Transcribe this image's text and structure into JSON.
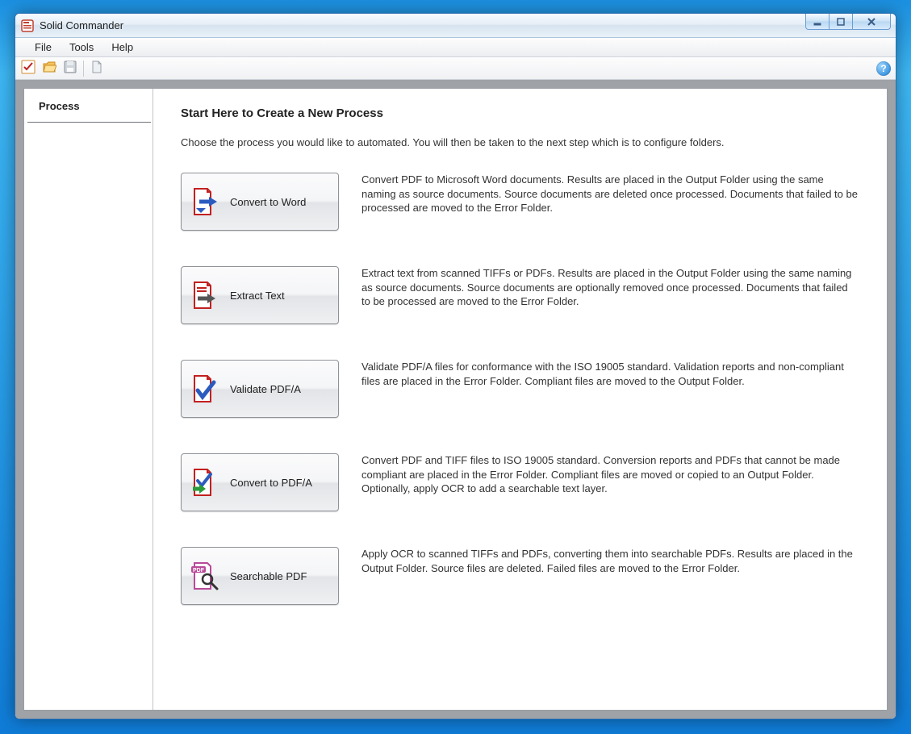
{
  "app": {
    "title": "Solid Commander"
  },
  "menus": {
    "file": "File",
    "tools": "Tools",
    "help": "Help"
  },
  "sidebar": {
    "tab": "Process"
  },
  "page": {
    "title": "Start Here to Create a New Process",
    "subtitle": "Choose the process you would like to automated. You will then be taken to the next step which is to configure folders."
  },
  "processes": [
    {
      "label": "Convert to Word",
      "desc": "Convert PDF to Microsoft Word documents. Results are placed in the Output Folder using the same naming as source documents. Source documents are deleted once processed. Documents that failed to be processed are moved to the Error Folder."
    },
    {
      "label": "Extract Text",
      "desc": "Extract text from scanned TIFFs or PDFs. Results are placed in the Output Folder using the same naming as source documents. Source documents are optionally removed once processed. Documents that failed to be processed are moved to the Error Folder."
    },
    {
      "label": "Validate PDF/A",
      "desc": "Validate PDF/A files for conformance with the ISO 19005 standard. Validation reports and non-compliant files are placed in the Error Folder. Compliant files are moved to the Output Folder."
    },
    {
      "label": "Convert to PDF/A",
      "desc": "Convert PDF and TIFF files to ISO 19005 standard. Conversion reports and PDFs that cannot be made compliant are placed in the Error Folder. Compliant files are moved or copied to an Output Folder. Optionally, apply OCR to add a searchable text layer."
    },
    {
      "label": "Searchable PDF",
      "desc": "Apply OCR to scanned TIFFs and PDFs, converting them into searchable PDFs. Results are placed in the Output Folder. Source files are deleted. Failed files are moved to the Error Folder."
    }
  ]
}
